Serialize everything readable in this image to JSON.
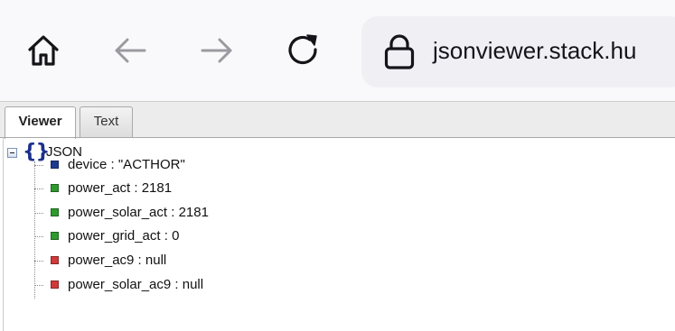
{
  "browser": {
    "url": "jsonviewer.stack.hu",
    "home_icon": "home-icon",
    "back_icon": "arrow-left-icon",
    "forward_icon": "arrow-right-icon",
    "reload_icon": "reload-icon",
    "lock_icon": "lock-icon"
  },
  "tabs": [
    {
      "label": "Viewer",
      "active": true
    },
    {
      "label": "Text",
      "active": false
    }
  ],
  "tree": {
    "root_icon": "{}",
    "root_label": "JSON",
    "nodes": [
      {
        "text": "device : \"ACTHOR\"",
        "type": "string",
        "color": "#1f3b8f"
      },
      {
        "text": "power_act : 2181",
        "type": "number",
        "color": "#2e9a2e"
      },
      {
        "text": "power_solar_act : 2181",
        "type": "number",
        "color": "#2e9a2e"
      },
      {
        "text": "power_grid_act : 0",
        "type": "number",
        "color": "#2e9a2e"
      },
      {
        "text": "power_ac9 : null",
        "type": "null",
        "color": "#d23a3a"
      },
      {
        "text": "power_solar_ac9 : null",
        "type": "null",
        "color": "#d23a3a"
      }
    ]
  }
}
